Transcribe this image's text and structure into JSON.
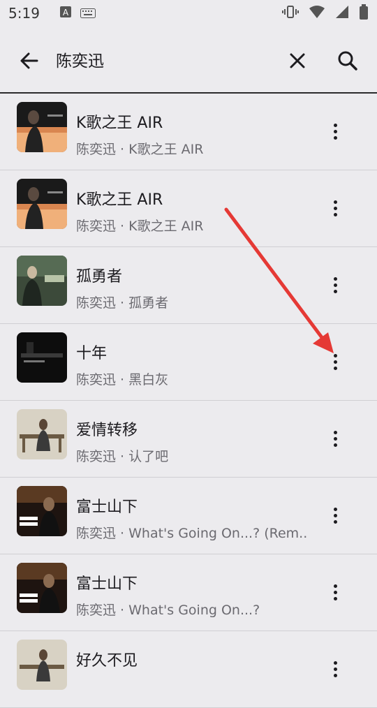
{
  "status_bar": {
    "time": "5:19"
  },
  "search": {
    "query": "陈奕迅"
  },
  "results": [
    {
      "title": "K歌之王 AIR",
      "subtitle": "陈奕迅 · K歌之王 AIR"
    },
    {
      "title": "K歌之王 AIR",
      "subtitle": "陈奕迅 · K歌之王 AIR"
    },
    {
      "title": "孤勇者",
      "subtitle": "陈奕迅 · 孤勇者"
    },
    {
      "title": "十年",
      "subtitle": "陈奕迅 · 黑白灰"
    },
    {
      "title": "爱情转移",
      "subtitle": "陈奕迅 · 认了吧"
    },
    {
      "title": "富士山下",
      "subtitle": "陈奕迅 · What's Going On...? (Rem..."
    },
    {
      "title": "富士山下",
      "subtitle": "陈奕迅 · What's Going On...?"
    },
    {
      "title": "好久不见",
      "subtitle": ""
    }
  ],
  "colors": {
    "annotation_arrow": "#e53935"
  }
}
